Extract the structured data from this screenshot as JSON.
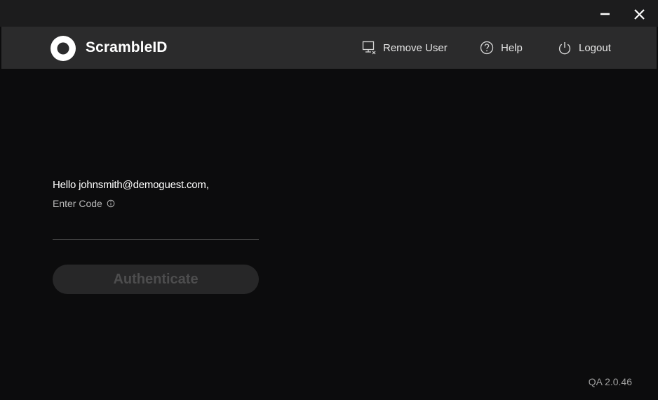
{
  "window": {
    "controls": {
      "minimize_icon": "minimize-icon",
      "close_icon": "close-icon"
    }
  },
  "header": {
    "app_name": "ScrambleID",
    "logo_icon": "scrambleid-logo",
    "nav": [
      {
        "label": "Remove User",
        "icon": "remove-user-icon"
      },
      {
        "label": "Help",
        "icon": "help-icon"
      },
      {
        "label": "Logout",
        "icon": "power-icon"
      }
    ]
  },
  "main": {
    "greeting": "Hello johnsmith@demoguest.com,",
    "code_label": "Enter Code",
    "code_value": "",
    "code_placeholder": "",
    "auth_button_label": "Authenticate"
  },
  "footer": {
    "version": "QA 2.0.46"
  },
  "colors": {
    "background": "#0c0c0d",
    "titlebar": "#1c1c1d",
    "header": "#2b2b2c",
    "text": "#ffffff",
    "muted": "#b9b9b9",
    "button_disabled_bg": "#272728",
    "button_disabled_text": "#4d4d4e"
  }
}
